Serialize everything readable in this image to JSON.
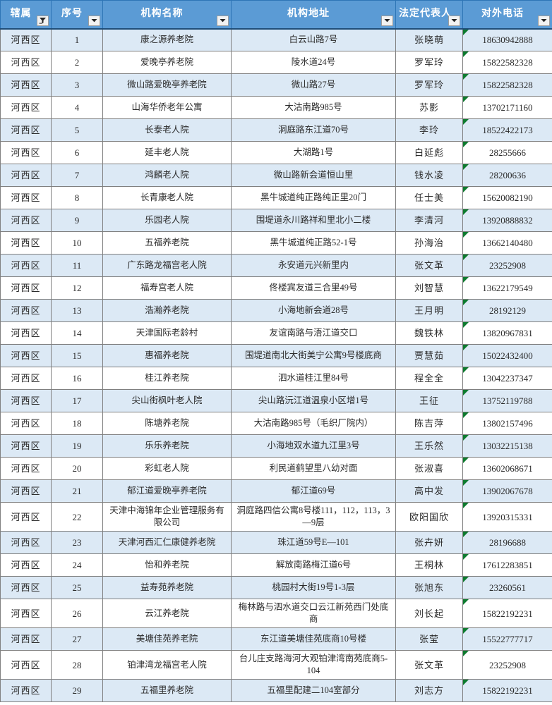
{
  "table": {
    "columns": [
      {
        "key": "area",
        "label": "辖属",
        "icon": "filter-applied-icon"
      },
      {
        "key": "seq",
        "label": "序号",
        "icon": "chevron-down-icon"
      },
      {
        "key": "name",
        "label": "机构名称",
        "icon": "chevron-down-icon"
      },
      {
        "key": "addr",
        "label": "机构地址",
        "icon": "chevron-down-icon"
      },
      {
        "key": "rep",
        "label": "法定代表人",
        "icon": "chevron-down-icon"
      },
      {
        "key": "phone",
        "label": "对外电话",
        "icon": "chevron-down-icon"
      }
    ],
    "header_bg": "#5b9bd5",
    "band_color": "#dce9f5",
    "comment_marker_color": "#0d7a2e",
    "rows": [
      {
        "area": "河西区",
        "seq": "1",
        "name": "康之源养老院",
        "addr": "白云山路7号",
        "rep": "张晓萌",
        "phone": "18630942888"
      },
      {
        "area": "河西区",
        "seq": "2",
        "name": "爱晚亭养老院",
        "addr": "陵水道24号",
        "rep": "罗军玲",
        "phone": "15822582328"
      },
      {
        "area": "河西区",
        "seq": "3",
        "name": "微山路爱晚亭养老院",
        "addr": "微山路27号",
        "rep": "罗军玲",
        "phone": "15822582328"
      },
      {
        "area": "河西区",
        "seq": "4",
        "name": "山海华侨老年公寓",
        "addr": "大沽南路985号",
        "rep": "苏影",
        "phone": "13702171160"
      },
      {
        "area": "河西区",
        "seq": "5",
        "name": "长泰老人院",
        "addr": "洞庭路东江道70号",
        "rep": "李玲",
        "phone": "18522422173"
      },
      {
        "area": "河西区",
        "seq": "6",
        "name": "延丰老人院",
        "addr": "大湖路1号",
        "rep": "白延彪",
        "phone": "28255666"
      },
      {
        "area": "河西区",
        "seq": "7",
        "name": "鸿麟老人院",
        "addr": "微山路新会道恒山里",
        "rep": "钱水凌",
        "phone": "28200636"
      },
      {
        "area": "河西区",
        "seq": "8",
        "name": "长青康老人院",
        "addr": "黑牛城道纯正路纯正里20门",
        "rep": "任士美",
        "phone": "15620082190"
      },
      {
        "area": "河西区",
        "seq": "9",
        "name": "乐园老人院",
        "addr": "围堤道永川路祥和里北小二楼",
        "rep": "李清河",
        "phone": "13920888832"
      },
      {
        "area": "河西区",
        "seq": "10",
        "name": "五福养老院",
        "addr": "黑牛城道纯正路52-1号",
        "rep": "孙海治",
        "phone": "13662140480"
      },
      {
        "area": "河西区",
        "seq": "11",
        "name": "广东路龙福宫老人院",
        "addr": "永安道元兴新里内",
        "rep": "张文革",
        "phone": "23252908"
      },
      {
        "area": "河西区",
        "seq": "12",
        "name": "福寿宫老人院",
        "addr": "佟楼宾友道三合里49号",
        "rep": "刘智慧",
        "phone": "13622179549"
      },
      {
        "area": "河西区",
        "seq": "13",
        "name": "浩瀚养老院",
        "addr": "小海地新会道28号",
        "rep": "王月明",
        "phone": "28192129"
      },
      {
        "area": "河西区",
        "seq": "14",
        "name": "天津国际老龄村",
        "addr": "友谊南路与浯江道交口",
        "rep": "魏铁林",
        "phone": "13820967831"
      },
      {
        "area": "河西区",
        "seq": "15",
        "name": "惠福养老院",
        "addr": "围堤道南北大街美宁公寓9号楼底商",
        "rep": "贾慧茹",
        "phone": "15022432400"
      },
      {
        "area": "河西区",
        "seq": "16",
        "name": "桂江养老院",
        "addr": "泗水道桂江里84号",
        "rep": "程全全",
        "phone": "13042237347"
      },
      {
        "area": "河西区",
        "seq": "17",
        "name": "尖山街枫叶老人院",
        "addr": "尖山路沅江道温泉小区增1号",
        "rep": "王征",
        "phone": "13752119788"
      },
      {
        "area": "河西区",
        "seq": "18",
        "name": "陈塘养老院",
        "addr": "大沽南路985号（毛织厂院内）",
        "rep": "陈吉萍",
        "phone": "13802157496"
      },
      {
        "area": "河西区",
        "seq": "19",
        "name": "乐乐养老院",
        "addr": "小海地双水道九江里3号",
        "rep": "王乐然",
        "phone": "13032215138"
      },
      {
        "area": "河西区",
        "seq": "20",
        "name": "彩虹老人院",
        "addr": "利民道鹤望里八幼对面",
        "rep": "张淑喜",
        "phone": "13602068671"
      },
      {
        "area": "河西区",
        "seq": "21",
        "name": "郁江道爱晚亭养老院",
        "addr": "郁江道69号",
        "rep": "高中发",
        "phone": "13902067678"
      },
      {
        "area": "河西区",
        "seq": "22",
        "name": "天津中海锦年企业管理服务有限公司",
        "addr": "洞庭路四信公寓8号楼111，112，113，3—9层",
        "rep": "欧阳国欣",
        "phone": "13920315331"
      },
      {
        "area": "河西区",
        "seq": "23",
        "name": "天津河西汇仁康健养老院",
        "addr": "珠江道59号E—101",
        "rep": "张卉妍",
        "phone": "28196688"
      },
      {
        "area": "河西区",
        "seq": "24",
        "name": "怡和养老院",
        "addr": "解放南路梅江道6号",
        "rep": "王桐林",
        "phone": "17612283851"
      },
      {
        "area": "河西区",
        "seq": "25",
        "name": "益寿苑养老院",
        "addr": "桃园村大街19号1-3层",
        "rep": "张旭东",
        "phone": "23260561"
      },
      {
        "area": "河西区",
        "seq": "26",
        "name": "云江养老院",
        "addr": "梅林路与泗水道交口云江新苑西门处底商",
        "rep": "刘长起",
        "phone": "15822192231"
      },
      {
        "area": "河西区",
        "seq": "27",
        "name": "美塘佳苑养老院",
        "addr": "东江道美塘佳苑底商10号楼",
        "rep": "张莹",
        "phone": "15522777717"
      },
      {
        "area": "河西区",
        "seq": "28",
        "name": "铂津湾龙福宫老人院",
        "addr": "台儿庄支路海河大观铂津湾南苑底商5-104",
        "rep": "张文革",
        "phone": "23252908"
      },
      {
        "area": "河西区",
        "seq": "29",
        "name": "五福里养老院",
        "addr": "五福里配建二104室部分",
        "rep": "刘志方",
        "phone": "15822192231"
      }
    ]
  }
}
